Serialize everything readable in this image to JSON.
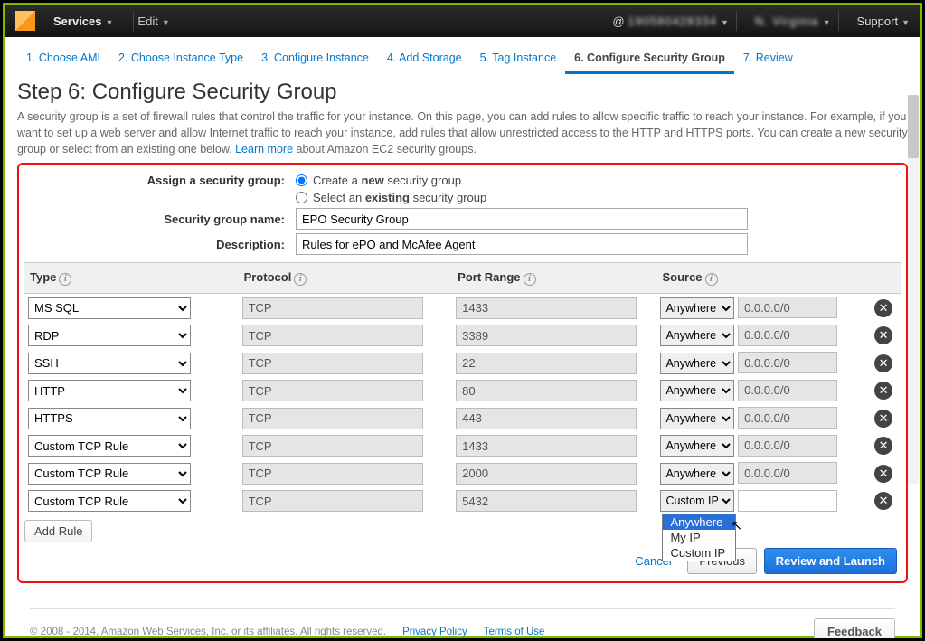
{
  "top_nav": {
    "services": "Services",
    "edit": "Edit",
    "account_prefix": "@",
    "account_id": "190580428334",
    "region": "N. Virginia",
    "support": "Support"
  },
  "wizard": {
    "s1": "1. Choose AMI",
    "s2": "2. Choose Instance Type",
    "s3": "3. Configure Instance",
    "s4": "4. Add Storage",
    "s5": "5. Tag Instance",
    "s6": "6. Configure Security Group",
    "s7": "7. Review"
  },
  "heading": "Step 6: Configure Security Group",
  "description_a": "A security group is a set of firewall rules that control the traffic for your instance. On this page, you can add rules to allow specific traffic to reach your instance. For example, if you want to set up a web server and allow Internet traffic to reach your instance, add rules that allow unrestricted access to the HTTP and HTTPS ports. You can create a new security group or select from an existing one below. ",
  "learn_more": "Learn more",
  "description_b": " about Amazon EC2 security groups.",
  "labels": {
    "assign": "Assign a security group:",
    "create_a": "Create a ",
    "create_b": "new",
    "create_c": " security group",
    "select_a": "Select an ",
    "select_b": "existing",
    "select_c": " security group",
    "sg_name": "Security group name:",
    "desc": "Description:",
    "add_rule": "Add Rule",
    "cancel": "Cancel",
    "previous": "Previous",
    "review": "Review and Launch"
  },
  "inputs": {
    "sg_name": "EPO Security Group",
    "desc": "Rules for ePO and McAfee Agent"
  },
  "columns": {
    "type": "Type",
    "protocol": "Protocol",
    "port": "Port Range",
    "source": "Source"
  },
  "rules": [
    {
      "type": "MS SQL",
      "protocol": "TCP",
      "port": "1433",
      "source_sel": "Anywhere",
      "cidr": "0.0.0.0/0",
      "cidr_editable": false
    },
    {
      "type": "RDP",
      "protocol": "TCP",
      "port": "3389",
      "source_sel": "Anywhere",
      "cidr": "0.0.0.0/0",
      "cidr_editable": false
    },
    {
      "type": "SSH",
      "protocol": "TCP",
      "port": "22",
      "source_sel": "Anywhere",
      "cidr": "0.0.0.0/0",
      "cidr_editable": false
    },
    {
      "type": "HTTP",
      "protocol": "TCP",
      "port": "80",
      "source_sel": "Anywhere",
      "cidr": "0.0.0.0/0",
      "cidr_editable": false
    },
    {
      "type": "HTTPS",
      "protocol": "TCP",
      "port": "443",
      "source_sel": "Anywhere",
      "cidr": "0.0.0.0/0",
      "cidr_editable": false
    },
    {
      "type": "Custom TCP Rule",
      "protocol": "TCP",
      "port": "1433",
      "source_sel": "Anywhere",
      "cidr": "0.0.0.0/0",
      "cidr_editable": false
    },
    {
      "type": "Custom TCP Rule",
      "protocol": "TCP",
      "port": "2000",
      "source_sel": "Anywhere",
      "cidr": "0.0.0.0/0",
      "cidr_editable": false
    },
    {
      "type": "Custom TCP Rule",
      "protocol": "TCP",
      "port": "5432",
      "source_sel": "Custom IP",
      "cidr": "",
      "cidr_editable": true
    }
  ],
  "dropdown": {
    "opt1": "Anywhere",
    "opt2": "My IP",
    "opt3": "Custom IP"
  },
  "footer": {
    "copyright": "© 2008 - 2014, Amazon Web Services, Inc. or its affiliates. All rights reserved.",
    "privacy": "Privacy Policy",
    "terms": "Terms of Use",
    "feedback": "Feedback"
  }
}
